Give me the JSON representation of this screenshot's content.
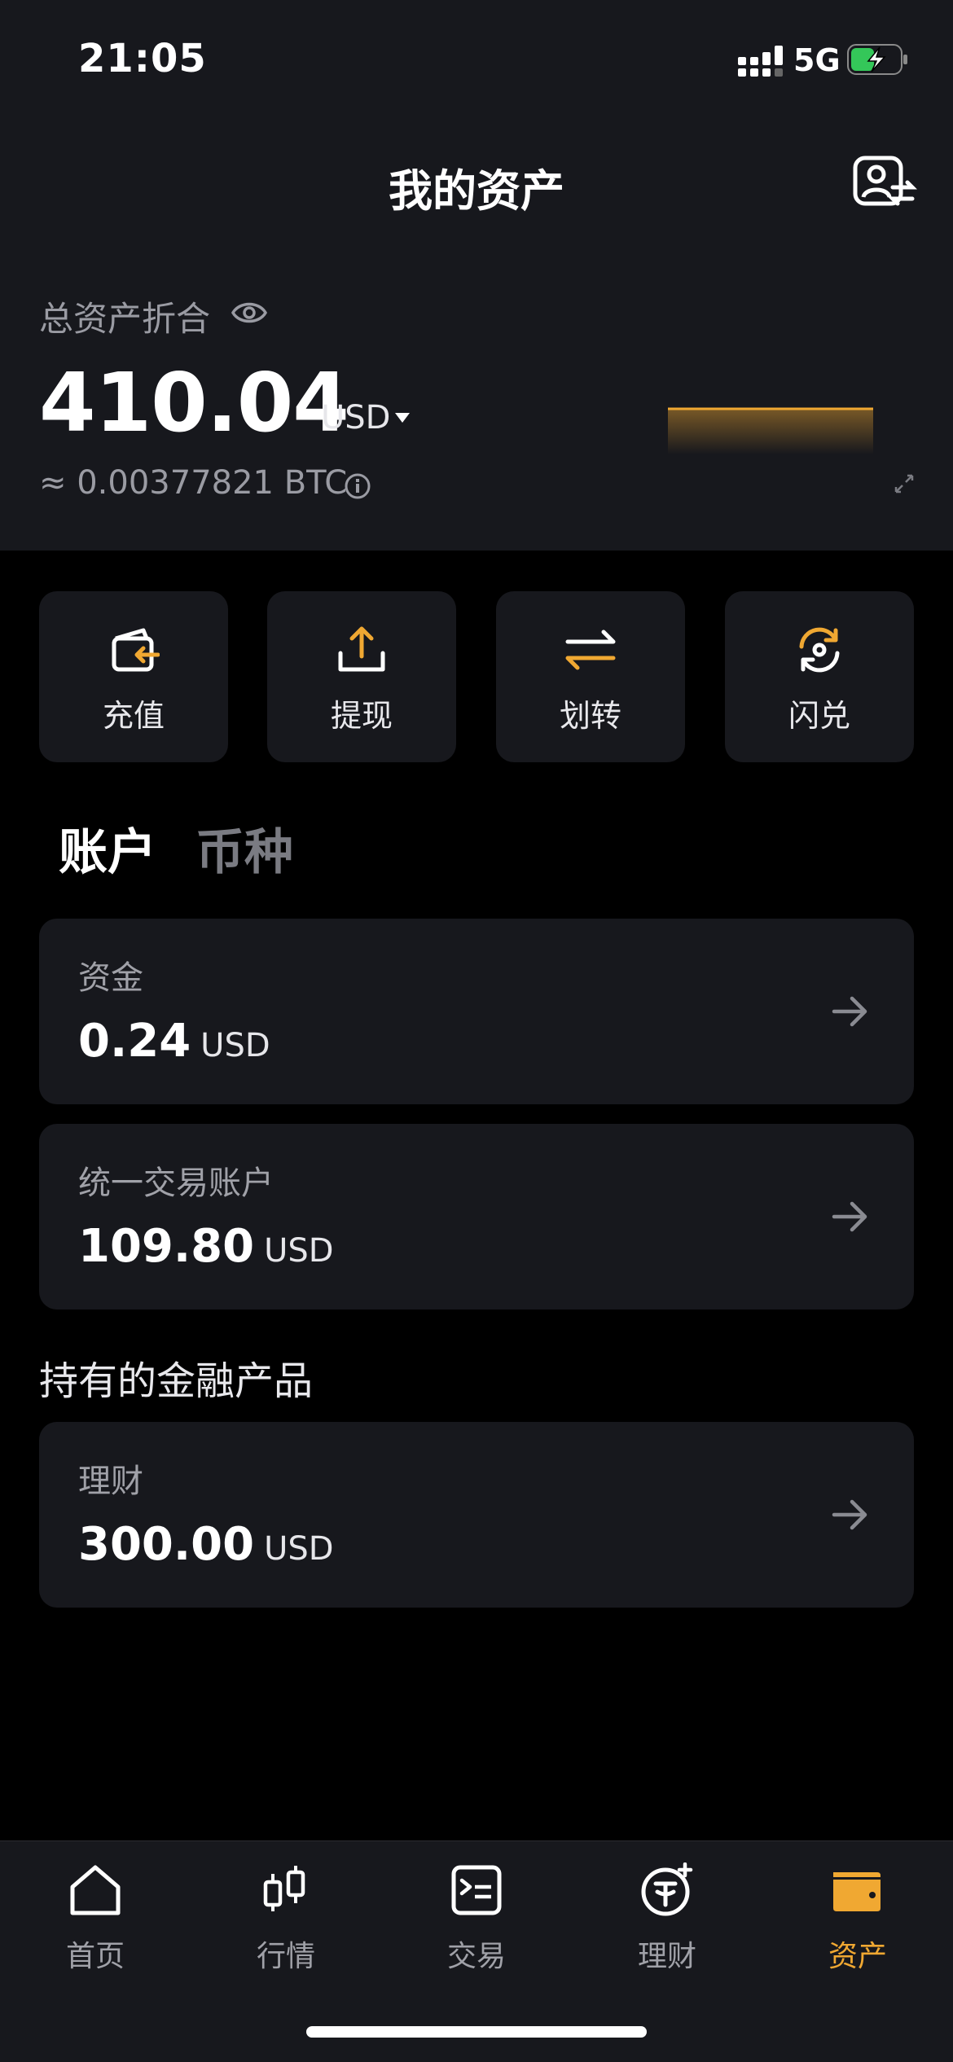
{
  "status": {
    "time": "21:05",
    "network": "5G"
  },
  "header": {
    "title": "我的资产"
  },
  "summary": {
    "label": "总资产折合",
    "total": "410.04",
    "currency": "USD",
    "btc": "≈ 0.00377821 BTC"
  },
  "actions": [
    {
      "label": "充值",
      "icon": "deposit-icon"
    },
    {
      "label": "提现",
      "icon": "withdraw-icon"
    },
    {
      "label": "划转",
      "icon": "transfer-icon"
    },
    {
      "label": "闪兑",
      "icon": "convert-icon"
    }
  ],
  "tabs": [
    {
      "label": "账户",
      "active": true
    },
    {
      "label": "币种",
      "active": false
    }
  ],
  "accounts": [
    {
      "name": "资金",
      "amount": "0.24",
      "currency": "USD"
    },
    {
      "name": "统一交易账户",
      "amount": "109.80",
      "currency": "USD"
    }
  ],
  "products_section": {
    "title": "持有的金融产品",
    "items": [
      {
        "name": "理财",
        "amount": "300.00",
        "currency": "USD"
      }
    ]
  },
  "nav": [
    {
      "label": "首页",
      "icon": "home-icon",
      "active": false
    },
    {
      "label": "行情",
      "icon": "candlestick-icon",
      "active": false
    },
    {
      "label": "交易",
      "icon": "trade-icon",
      "active": false
    },
    {
      "label": "理财",
      "icon": "earn-icon",
      "active": false
    },
    {
      "label": "资产",
      "icon": "wallet-icon",
      "active": true
    }
  ],
  "colors": {
    "accent": "#f0a832",
    "background": "#000000",
    "card": "#17181d"
  }
}
